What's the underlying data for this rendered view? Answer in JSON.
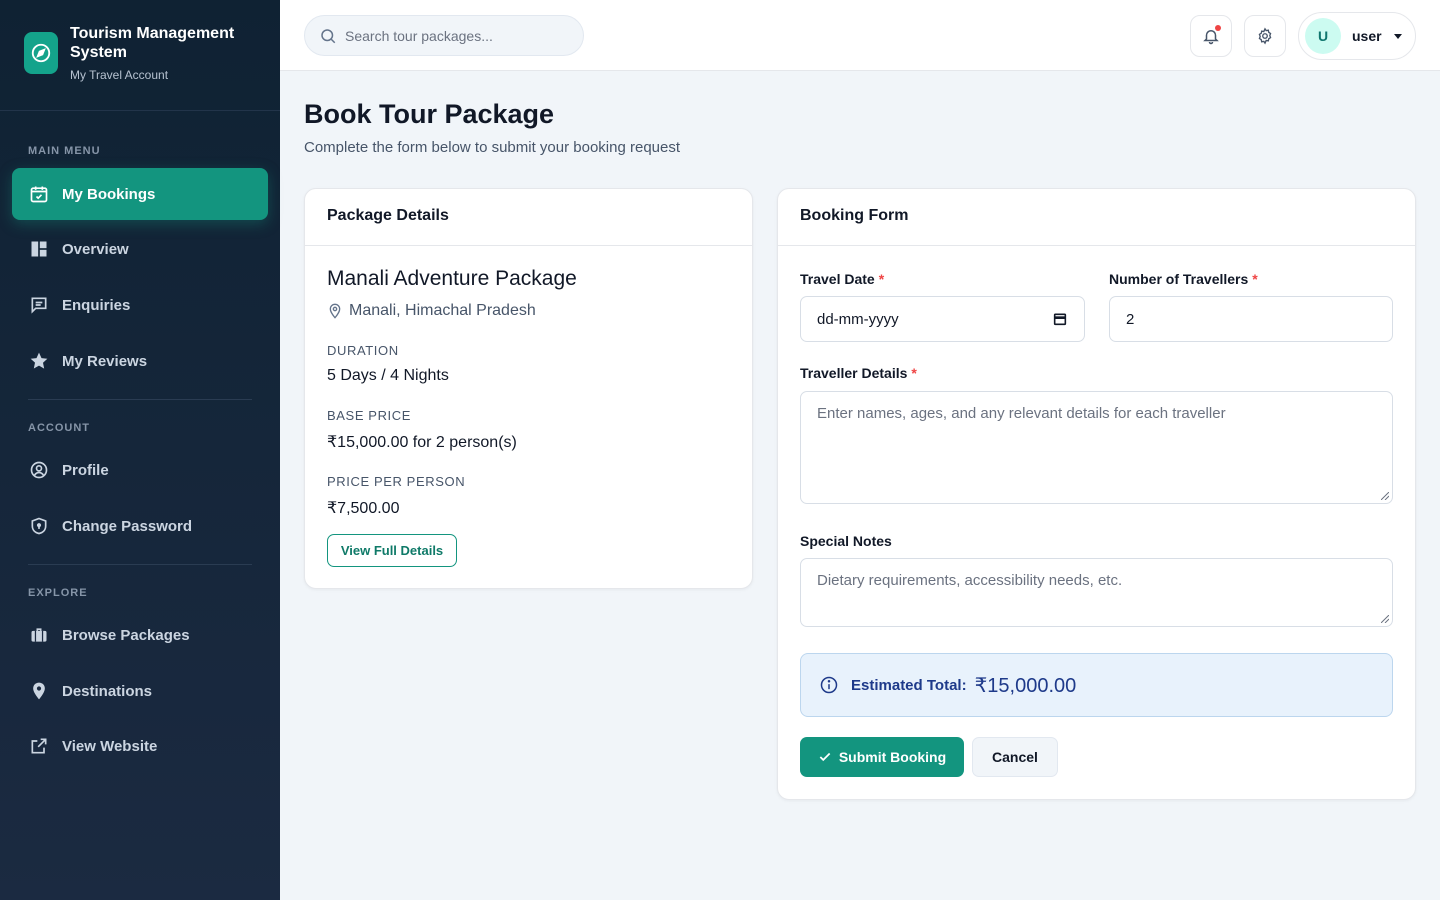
{
  "brand": {
    "title": "Tourism Management System",
    "subtitle": "My Travel Account",
    "logo_icon": "compass-icon",
    "accent": "#13957f"
  },
  "sidebar": {
    "sections": {
      "main": "MAIN MENU",
      "account": "ACCOUNT",
      "explore": "EXPLORE"
    },
    "items": [
      {
        "label": "My Bookings",
        "icon": "calendar-check-icon",
        "active": true
      },
      {
        "label": "Overview",
        "icon": "dashboard-icon",
        "active": false
      },
      {
        "label": "Enquiries",
        "icon": "message-icon",
        "active": false
      },
      {
        "label": "My Reviews",
        "icon": "star-icon",
        "active": false
      },
      {
        "label": "Profile",
        "icon": "user-circle-icon",
        "active": false
      },
      {
        "label": "Change Password",
        "icon": "shield-icon",
        "active": false
      },
      {
        "label": "Browse Packages",
        "icon": "suitcase-icon",
        "active": false
      },
      {
        "label": "Destinations",
        "icon": "map-pin-icon",
        "active": false
      },
      {
        "label": "View Website",
        "icon": "external-link-icon",
        "active": false
      }
    ]
  },
  "topbar": {
    "search_placeholder": "Search tour packages...",
    "user_initial": "U",
    "user_name": "user"
  },
  "page": {
    "title": "Book Tour Package",
    "subtitle": "Complete the form below to submit your booking request"
  },
  "package": {
    "header": "Package Details",
    "name": "Manali Adventure Package",
    "location": "Manali, Himachal Pradesh",
    "duration_label": "DURATION",
    "duration": "5 Days / 4 Nights",
    "base_price_label": "BASE PRICE",
    "base_price": "₹15,000.00 for 2 person(s)",
    "per_person_label": "PRICE PER PERSON",
    "per_person": "₹7,500.00",
    "view_button": "View Full Details"
  },
  "form": {
    "header": "Booking Form",
    "travel_date_label": "Travel Date",
    "travel_date_value": "dd-mm-yyyy",
    "travellers_label": "Number of Travellers",
    "travellers_value": "2",
    "traveller_details_label": "Traveller Details",
    "traveller_details_placeholder": "Enter names, ages, and any relevant details for each traveller",
    "notes_label": "Special Notes",
    "notes_placeholder": "Dietary requirements, accessibility needs, etc.",
    "required_mark": "*",
    "estimate_label": "Estimated Total:",
    "estimate_value": "₹15,000.00",
    "submit_label": "Submit Booking",
    "cancel_label": "Cancel"
  }
}
